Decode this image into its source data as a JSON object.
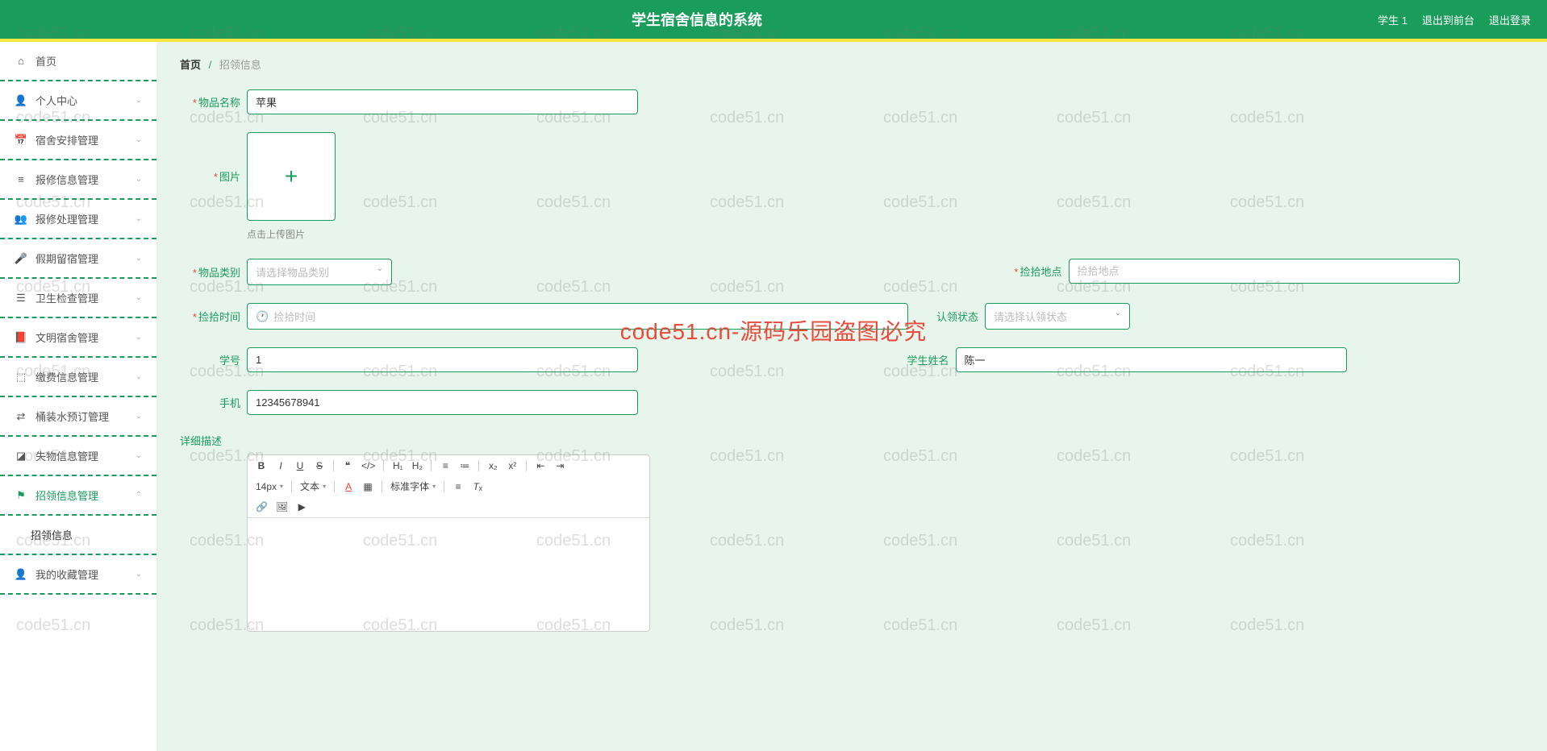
{
  "header": {
    "title": "学生宿舍信息的系统",
    "user": "学生 1",
    "back_front": "退出到前台",
    "logout": "退出登录"
  },
  "sidebar": {
    "items": [
      {
        "icon": "home",
        "label": "首页",
        "arrow": ""
      },
      {
        "icon": "user",
        "label": "个人中心",
        "arrow": "⌄"
      },
      {
        "icon": "calendar",
        "label": "宿舍安排管理",
        "arrow": "⌄"
      },
      {
        "icon": "repair",
        "label": "报修信息管理",
        "arrow": "⌄"
      },
      {
        "icon": "process",
        "label": "报修处理管理",
        "arrow": "⌄"
      },
      {
        "icon": "mic",
        "label": "假期留宿管理",
        "arrow": "⌄"
      },
      {
        "icon": "check",
        "label": "卫生检查管理",
        "arrow": "⌄"
      },
      {
        "icon": "book",
        "label": "文明宿舍管理",
        "arrow": "⌄"
      },
      {
        "icon": "fee",
        "label": "缴费信息管理",
        "arrow": "⌄"
      },
      {
        "icon": "water",
        "label": "桶装水预订管理",
        "arrow": "⌄"
      },
      {
        "icon": "lost",
        "label": "失物信息管理",
        "arrow": "⌄"
      },
      {
        "icon": "claim",
        "label": "招领信息管理",
        "arrow": "⌃",
        "active": true
      },
      {
        "icon": "",
        "label": "招领信息",
        "sub": true
      },
      {
        "icon": "star",
        "label": "我的收藏管理",
        "arrow": "⌄"
      }
    ]
  },
  "breadcrumb": {
    "home": "首页",
    "current": "招领信息"
  },
  "form": {
    "item_name_label": "物品名称",
    "item_name_value": "苹果",
    "image_label": "图片",
    "image_hint": "点击上传图片",
    "category_label": "物品类别",
    "category_placeholder": "请选择物品类别",
    "location_label": "捡拾地点",
    "location_placeholder": "捡拾地点",
    "time_label": "捡拾时间",
    "time_placeholder": "捡拾时间",
    "status_label": "认领状态",
    "status_placeholder": "请选择认领状态",
    "student_id_label": "学号",
    "student_id_value": "1",
    "student_name_label": "学生姓名",
    "student_name_value": "陈一",
    "phone_label": "手机",
    "phone_value": "12345678941",
    "desc_label": "详细描述"
  },
  "editor": {
    "font_size": "14px",
    "text_type": "文本",
    "font_family": "标准字体"
  },
  "watermark": {
    "text": "code51.cn",
    "red": "code51.cn-源码乐园盗图必究"
  }
}
